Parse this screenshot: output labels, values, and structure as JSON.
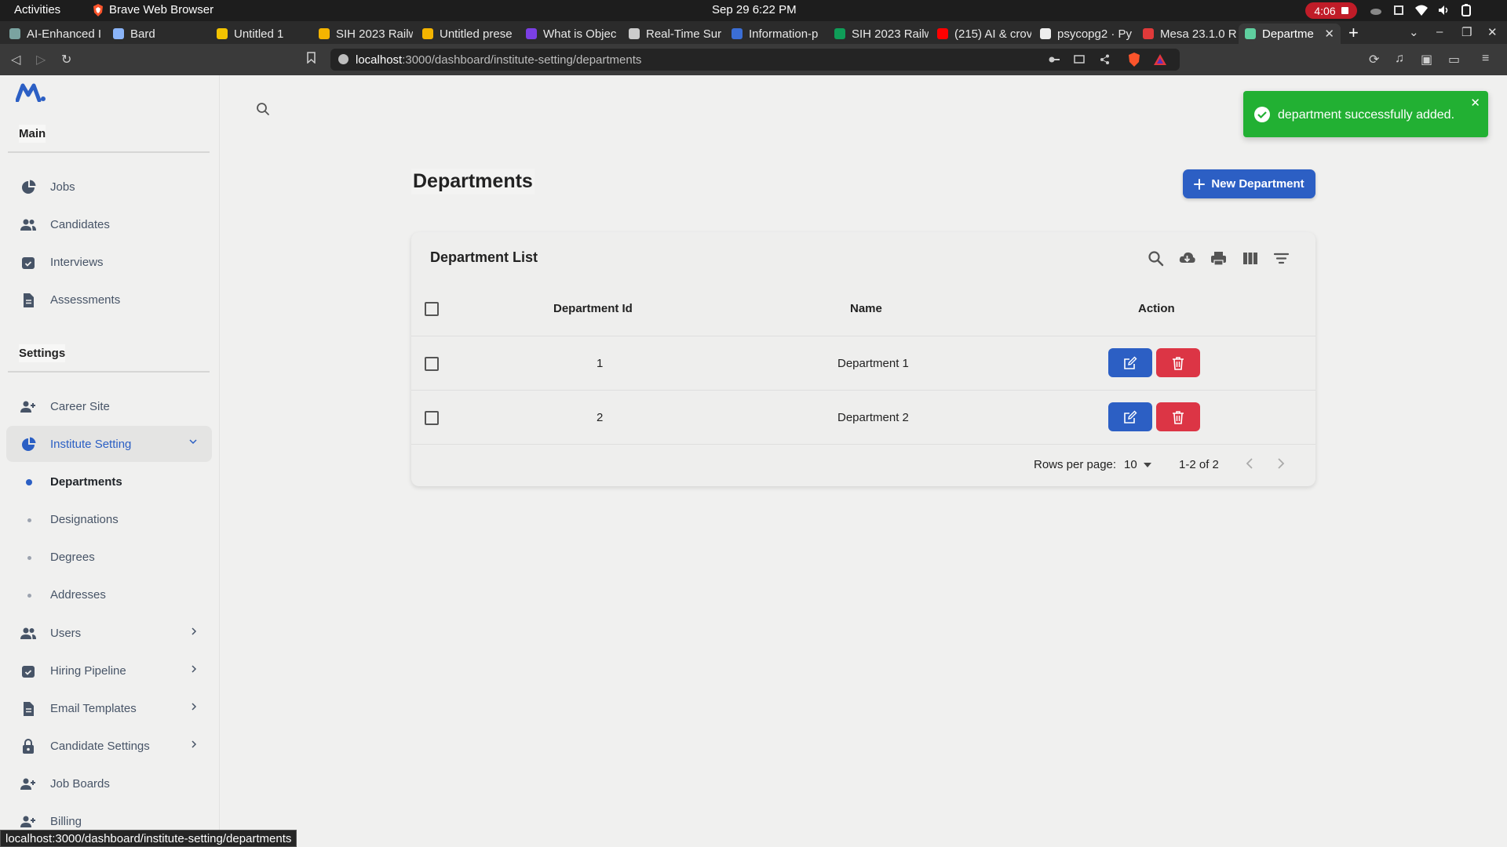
{
  "system": {
    "activities": "Activities",
    "app_name": "Brave Web Browser",
    "clock": "Sep 29  6:22 PM",
    "recording": "4:06"
  },
  "browser": {
    "tabs": [
      {
        "title": "AI-Enhanced I",
        "color": "#7aa3a0"
      },
      {
        "title": "Bard",
        "color": "#8ab4f8"
      },
      {
        "title": "Untitled 1",
        "color": "#f3c300"
      },
      {
        "title": "SIH 2023 Railw",
        "color": "#f4b400"
      },
      {
        "title": "Untitled prese",
        "color": "#f4b400"
      },
      {
        "title": "What is Objec",
        "color": "#7b3fe4"
      },
      {
        "title": "Real-Time Sur",
        "color": "#cccccc"
      },
      {
        "title": "Information-p",
        "color": "#3b6ed5"
      },
      {
        "title": "SIH 2023 Railw",
        "color": "#0f9d58"
      },
      {
        "title": "(215) AI & crov",
        "color": "#ff0000"
      },
      {
        "title": "psycopg2 · Py",
        "color": "#eeeeee"
      },
      {
        "title": "Mesa 23.1.0 R",
        "color": "#e03a3a"
      },
      {
        "title": "Departme",
        "color": "#5fcf9f"
      }
    ],
    "url_host": "localhost",
    "url_path": ":3000/dashboard/institute-setting/departments",
    "status_url": "localhost:3000/dashboard/institute-setting/departments"
  },
  "sidebar": {
    "main_heading": "Main",
    "main_items": [
      {
        "label": "Jobs",
        "icon": "pie-chart-icon"
      },
      {
        "label": "Candidates",
        "icon": "users-icon"
      },
      {
        "label": "Interviews",
        "icon": "calendar-check-icon"
      },
      {
        "label": "Assessments",
        "icon": "document-icon"
      }
    ],
    "settings_heading": "Settings",
    "settings_items": [
      {
        "label": "Career Site",
        "icon": "user-plus-icon"
      },
      {
        "label": "Institute Setting",
        "icon": "pie-chart-icon"
      },
      {
        "label": "Users",
        "icon": "users-icon"
      },
      {
        "label": "Hiring Pipeline",
        "icon": "calendar-check-icon"
      },
      {
        "label": "Email Templates",
        "icon": "document-icon"
      },
      {
        "label": "Candidate Settings",
        "icon": "lock-icon"
      },
      {
        "label": "Job Boards",
        "icon": "user-plus-icon"
      },
      {
        "label": "Billing",
        "icon": "user-plus-icon"
      }
    ],
    "sub_items": [
      "Departments",
      "Designations",
      "Degrees",
      "Addresses"
    ]
  },
  "page": {
    "title": "Departments",
    "new_button": "New Department"
  },
  "table": {
    "title": "Department List",
    "headers": {
      "id": "Department Id",
      "name": "Name",
      "action": "Action"
    },
    "rows": [
      {
        "id": "1",
        "name": "Department 1"
      },
      {
        "id": "2",
        "name": "Department 2"
      }
    ],
    "rows_per_page_label": "Rows per page:",
    "rows_per_page": "10",
    "range": "1-2 of 2"
  },
  "toast": {
    "message": "department successfully added.",
    "color": "#22b033"
  },
  "colors": {
    "primary": "#2c5fc4",
    "danger": "#dc3545"
  }
}
